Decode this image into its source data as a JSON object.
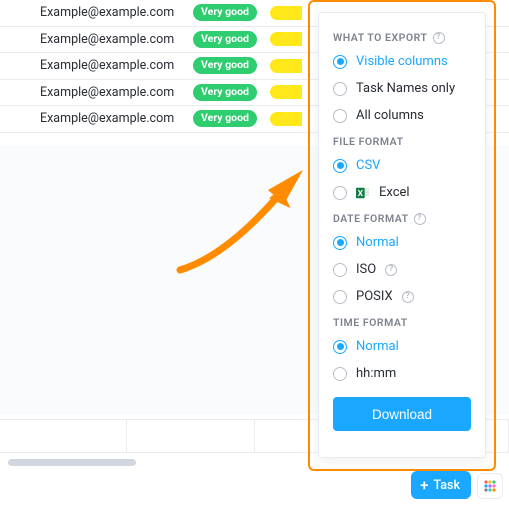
{
  "table": {
    "rows": [
      {
        "email": "Example@example.com",
        "badge": "Very good"
      },
      {
        "email": "Example@example.com",
        "badge": "Very good"
      },
      {
        "email": "Example@example.com",
        "badge": "Very good"
      },
      {
        "email": "Example@example.com",
        "badge": "Very good"
      },
      {
        "email": "Example@example.com",
        "badge": "Very good"
      }
    ]
  },
  "export": {
    "what_head": "WHAT TO EXPORT",
    "what": {
      "visible": "Visible columns",
      "names": "Task Names only",
      "all": "All columns",
      "selected": "visible"
    },
    "format_head": "FILE FORMAT",
    "format": {
      "csv": "CSV",
      "excel": "Excel",
      "selected": "csv"
    },
    "date_head": "DATE FORMAT",
    "date": {
      "normal": "Normal",
      "iso": "ISO",
      "posix": "POSIX",
      "selected": "normal"
    },
    "time_head": "TIME FORMAT",
    "time": {
      "normal": "Normal",
      "hhmm": "hh:mm",
      "selected": "normal"
    },
    "download": "Download"
  },
  "task_button": "Task"
}
